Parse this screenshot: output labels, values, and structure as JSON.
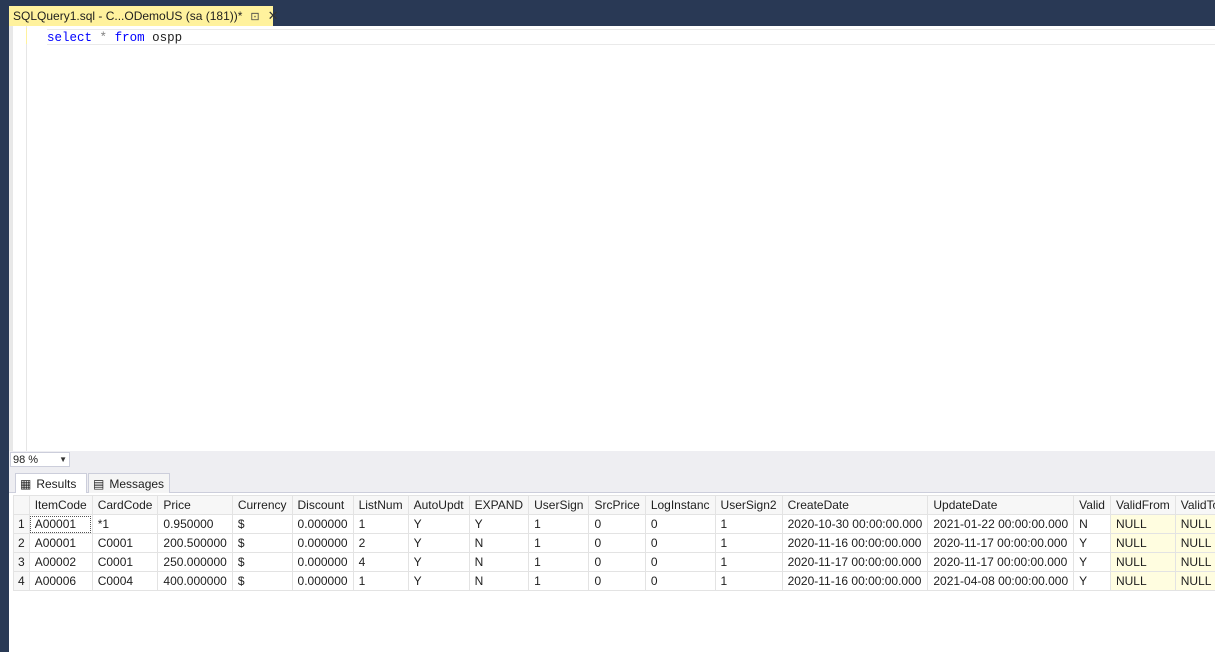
{
  "tab": {
    "title": "SQLQuery1.sql - C...ODemoUS (sa (181))*",
    "pin_icon": "pin-icon",
    "close_icon": "close-icon"
  },
  "editor": {
    "tokens": [
      {
        "text": "select",
        "kind": "keyword"
      },
      {
        "text": " ",
        "kind": "space"
      },
      {
        "text": "*",
        "kind": "operator"
      },
      {
        "text": " ",
        "kind": "space"
      },
      {
        "text": "from",
        "kind": "keyword"
      },
      {
        "text": " ",
        "kind": "space"
      },
      {
        "text": "ospp",
        "kind": "identifier"
      }
    ]
  },
  "zoom": {
    "value": "98 %"
  },
  "results_tabs": [
    {
      "label": "Results",
      "icon": "grid-icon",
      "active": true
    },
    {
      "label": "Messages",
      "icon": "messages-icon",
      "active": false
    }
  ],
  "grid": {
    "columns": [
      "",
      "ItemCode",
      "CardCode",
      "Price",
      "Currency",
      "Discount",
      "ListNum",
      "AutoUpdt",
      "EXPAND",
      "UserSign",
      "SrcPrice",
      "LogInstanc",
      "UserSign2",
      "CreateDate",
      "UpdateDate",
      "Valid",
      "ValidFrom",
      "ValidTo"
    ],
    "rows": [
      [
        "1",
        "A00001",
        "*1",
        "0.950000",
        "$",
        "0.000000",
        "1",
        "Y",
        "Y",
        "1",
        "0",
        "0",
        "1",
        "2020-10-30 00:00:00.000",
        "2021-01-22 00:00:00.000",
        "N",
        "NULL",
        "NULL"
      ],
      [
        "2",
        "A00001",
        "C0001",
        "200.500000",
        "$",
        "0.000000",
        "2",
        "Y",
        "N",
        "1",
        "0",
        "0",
        "1",
        "2020-11-16 00:00:00.000",
        "2020-11-17 00:00:00.000",
        "Y",
        "NULL",
        "NULL"
      ],
      [
        "3",
        "A00002",
        "C0001",
        "250.000000",
        "$",
        "0.000000",
        "4",
        "Y",
        "N",
        "1",
        "0",
        "0",
        "1",
        "2020-11-17 00:00:00.000",
        "2020-11-17 00:00:00.000",
        "Y",
        "NULL",
        "NULL"
      ],
      [
        "4",
        "A00006",
        "C0004",
        "400.000000",
        "$",
        "0.000000",
        "1",
        "Y",
        "N",
        "1",
        "0",
        "0",
        "1",
        "2020-11-16 00:00:00.000",
        "2021-04-08 00:00:00.000",
        "Y",
        "NULL",
        "NULL"
      ]
    ]
  },
  "colors": {
    "chrome": "#293955",
    "tab_active": "#fff29d",
    "keyword": "#0000ff",
    "null_cell": "#fffde0"
  }
}
